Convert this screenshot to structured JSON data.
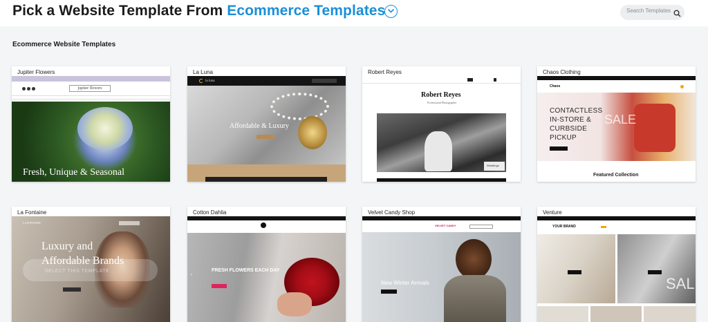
{
  "header": {
    "title_prefix": "Pick a Website Template From ",
    "title_category": "Ecommerce Templates",
    "accent_color": "#1a8fd8",
    "search_placeholder": "Search Templates"
  },
  "section_title": "Ecommerce Website Templates",
  "templates": [
    {
      "name": "Jupiter Flowers",
      "hero_text": "Fresh, Unique & Seasonal",
      "brand": "jupiter flowers"
    },
    {
      "name": "La Luna",
      "hero_text": "Affordable & Luxury",
      "brand": "la luna"
    },
    {
      "name": "Robert Reyes",
      "hero_text": "Robert Reyes",
      "sub_text": "Professional Photographer",
      "caption": "Weddings"
    },
    {
      "name": "Chaos Clothing",
      "hero_text": "CONTACTLESS IN-STORE & CURBSIDE PICKUP",
      "brand": "Chaos",
      "footer_text": "Featured Collection",
      "overlay": "SALE"
    },
    {
      "name": "La Fontaine",
      "hero_text": "Luxury and Affordable Brands",
      "brand": "LA FONTAINE",
      "overlay_button": "SELECT THIS TEMPLATE"
    },
    {
      "name": "Cotton Dahlia",
      "hero_text": "FRESH FLOWERS EACH DAY"
    },
    {
      "name": "Velvet Candy Shop",
      "hero_text": "New Winter Arrivals",
      "brand": "VELVET CANDY"
    },
    {
      "name": "Venture",
      "brand": "YOUR BRAND",
      "overlay": "SAL"
    }
  ]
}
